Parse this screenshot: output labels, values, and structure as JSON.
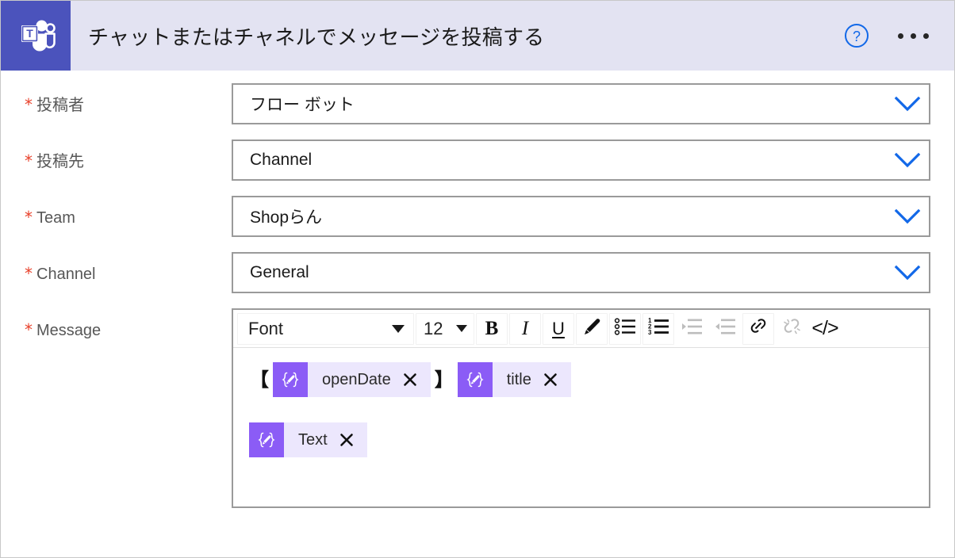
{
  "window": {
    "title": "チャットまたはチャネルでメッセージを投稿する",
    "app_icon": "microsoft-teams-icon",
    "help_icon": "help-circle-icon",
    "more_icon": "ellipsis-icon",
    "accent_color": "#4b53bc",
    "header_background": "#e3e3f2",
    "chevron_color": "#1268e8",
    "required_marker": "*",
    "required_color": "#e8402a"
  },
  "form": {
    "fields": [
      {
        "label": "投稿者",
        "required": true,
        "value": "フロー ボット",
        "control": "dropdown",
        "icon": "chevron-down-icon"
      },
      {
        "label": "投稿先",
        "required": true,
        "value": "Channel",
        "control": "dropdown",
        "icon": "chevron-down-icon"
      },
      {
        "label": "Team",
        "required": true,
        "value": "Shopらん",
        "control": "dropdown",
        "icon": "chevron-down-icon"
      },
      {
        "label": "Channel",
        "required": true,
        "value": "General",
        "control": "dropdown",
        "icon": "chevron-down-icon"
      }
    ],
    "message": {
      "label": "Message",
      "required": true,
      "toolbar": {
        "font_name": "Font",
        "font_size": "12",
        "buttons": [
          {
            "name": "bold-button",
            "glyph": "B",
            "enabled": true
          },
          {
            "name": "italic-button",
            "glyph": "I",
            "enabled": true
          },
          {
            "name": "underline-button",
            "glyph": "U",
            "enabled": true
          },
          {
            "name": "highlight-button",
            "glyph": "pencil-icon",
            "enabled": true
          },
          {
            "name": "bulleted-list-button",
            "glyph": "bullet-list-icon",
            "enabled": true
          },
          {
            "name": "numbered-list-button",
            "glyph": "numbered-list-icon",
            "enabled": true
          },
          {
            "name": "indent-button",
            "glyph": "indent-icon",
            "enabled": false
          },
          {
            "name": "outdent-button",
            "glyph": "outdent-icon",
            "enabled": false
          },
          {
            "name": "insert-link-button",
            "glyph": "link-icon",
            "enabled": true
          },
          {
            "name": "remove-link-button",
            "glyph": "unlink-icon",
            "enabled": false
          },
          {
            "name": "code-view-button",
            "glyph": "</>",
            "enabled": true
          }
        ]
      },
      "content": {
        "lines": [
          {
            "parts": [
              {
                "type": "text",
                "value": "【"
              },
              {
                "type": "token",
                "value": "openDate",
                "icon": "dynamic-content-icon",
                "remove": "×"
              },
              {
                "type": "text",
                "value": "】"
              },
              {
                "type": "token",
                "value": "title",
                "icon": "dynamic-content-icon",
                "remove": "×"
              }
            ]
          },
          {
            "parts": [
              {
                "type": "token",
                "value": "Text",
                "icon": "dynamic-content-icon",
                "remove": "×"
              }
            ]
          }
        ],
        "token_colors": {
          "icon_bg": "#8b5cf6",
          "pill_bg": "#ece7fd"
        }
      }
    }
  }
}
